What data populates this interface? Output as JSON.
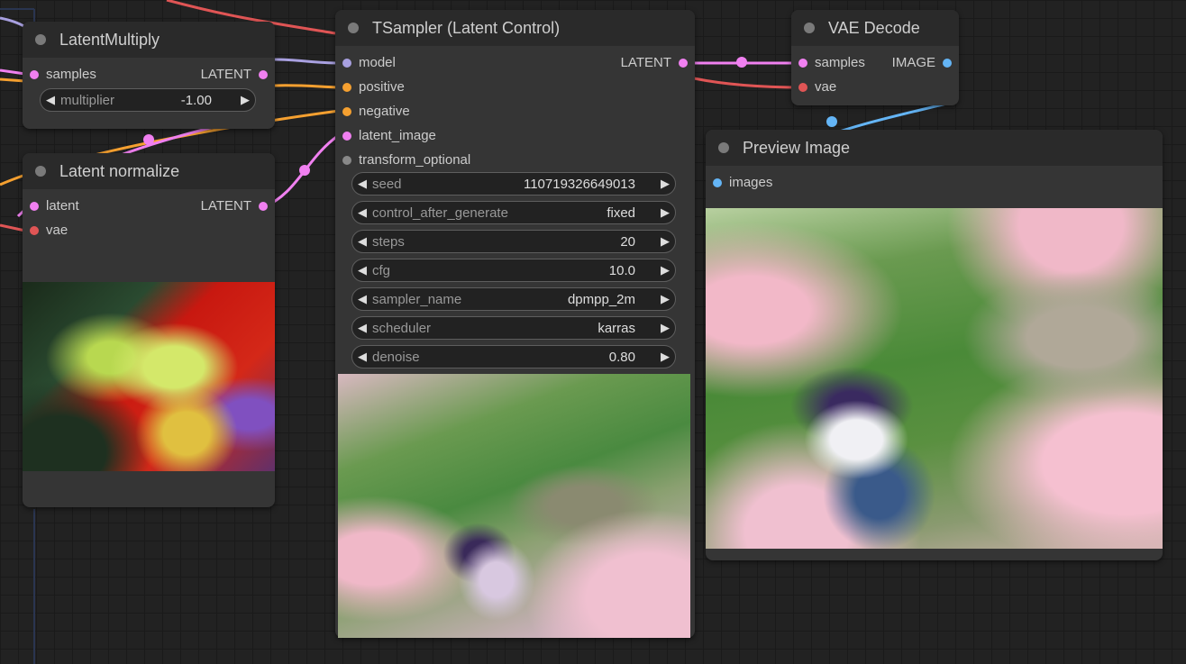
{
  "nodes": {
    "latent_multiply": {
      "title": "LatentMultiply",
      "inputs": [
        {
          "label": "samples",
          "color": "#f080f0"
        }
      ],
      "output": {
        "label": "LATENT",
        "color": "#f080f0"
      },
      "widgets": [
        {
          "label": "multiplier",
          "value": "-1.00"
        }
      ]
    },
    "latent_normalize": {
      "title": "Latent normalize",
      "inputs": [
        {
          "label": "latent",
          "color": "#f080f0"
        },
        {
          "label": "vae",
          "color": "#e05555"
        }
      ],
      "output": {
        "label": "LATENT",
        "color": "#f080f0"
      }
    },
    "tsampler": {
      "title": "TSampler (Latent Control)",
      "inputs": [
        {
          "label": "model",
          "color": "#a8a0e0"
        },
        {
          "label": "positive",
          "color": "#f5a030"
        },
        {
          "label": "negative",
          "color": "#f5a030"
        },
        {
          "label": "latent_image",
          "color": "#f080f0"
        },
        {
          "label": "transform_optional",
          "color": "#888888"
        }
      ],
      "output": {
        "label": "LATENT",
        "color": "#f080f0"
      },
      "widgets": [
        {
          "label": "seed",
          "value": "110719326649013"
        },
        {
          "label": "control_after_generate",
          "value": "fixed"
        },
        {
          "label": "steps",
          "value": "20"
        },
        {
          "label": "cfg",
          "value": "10.0"
        },
        {
          "label": "sampler_name",
          "value": "dpmpp_2m"
        },
        {
          "label": "scheduler",
          "value": "karras"
        },
        {
          "label": "denoise",
          "value": "0.80"
        }
      ]
    },
    "vae_decode": {
      "title": "VAE Decode",
      "inputs": [
        {
          "label": "samples",
          "color": "#f080f0"
        },
        {
          "label": "vae",
          "color": "#e05555"
        }
      ],
      "output": {
        "label": "IMAGE",
        "color": "#64b5f6"
      }
    },
    "preview_image": {
      "title": "Preview Image",
      "inputs": [
        {
          "label": "images",
          "color": "#64b5f6"
        }
      ]
    }
  },
  "colors": {
    "latent": "#f080f0",
    "model": "#a8a0e0",
    "conditioning": "#f5a030",
    "vae": "#e05555",
    "image": "#64b5f6"
  }
}
